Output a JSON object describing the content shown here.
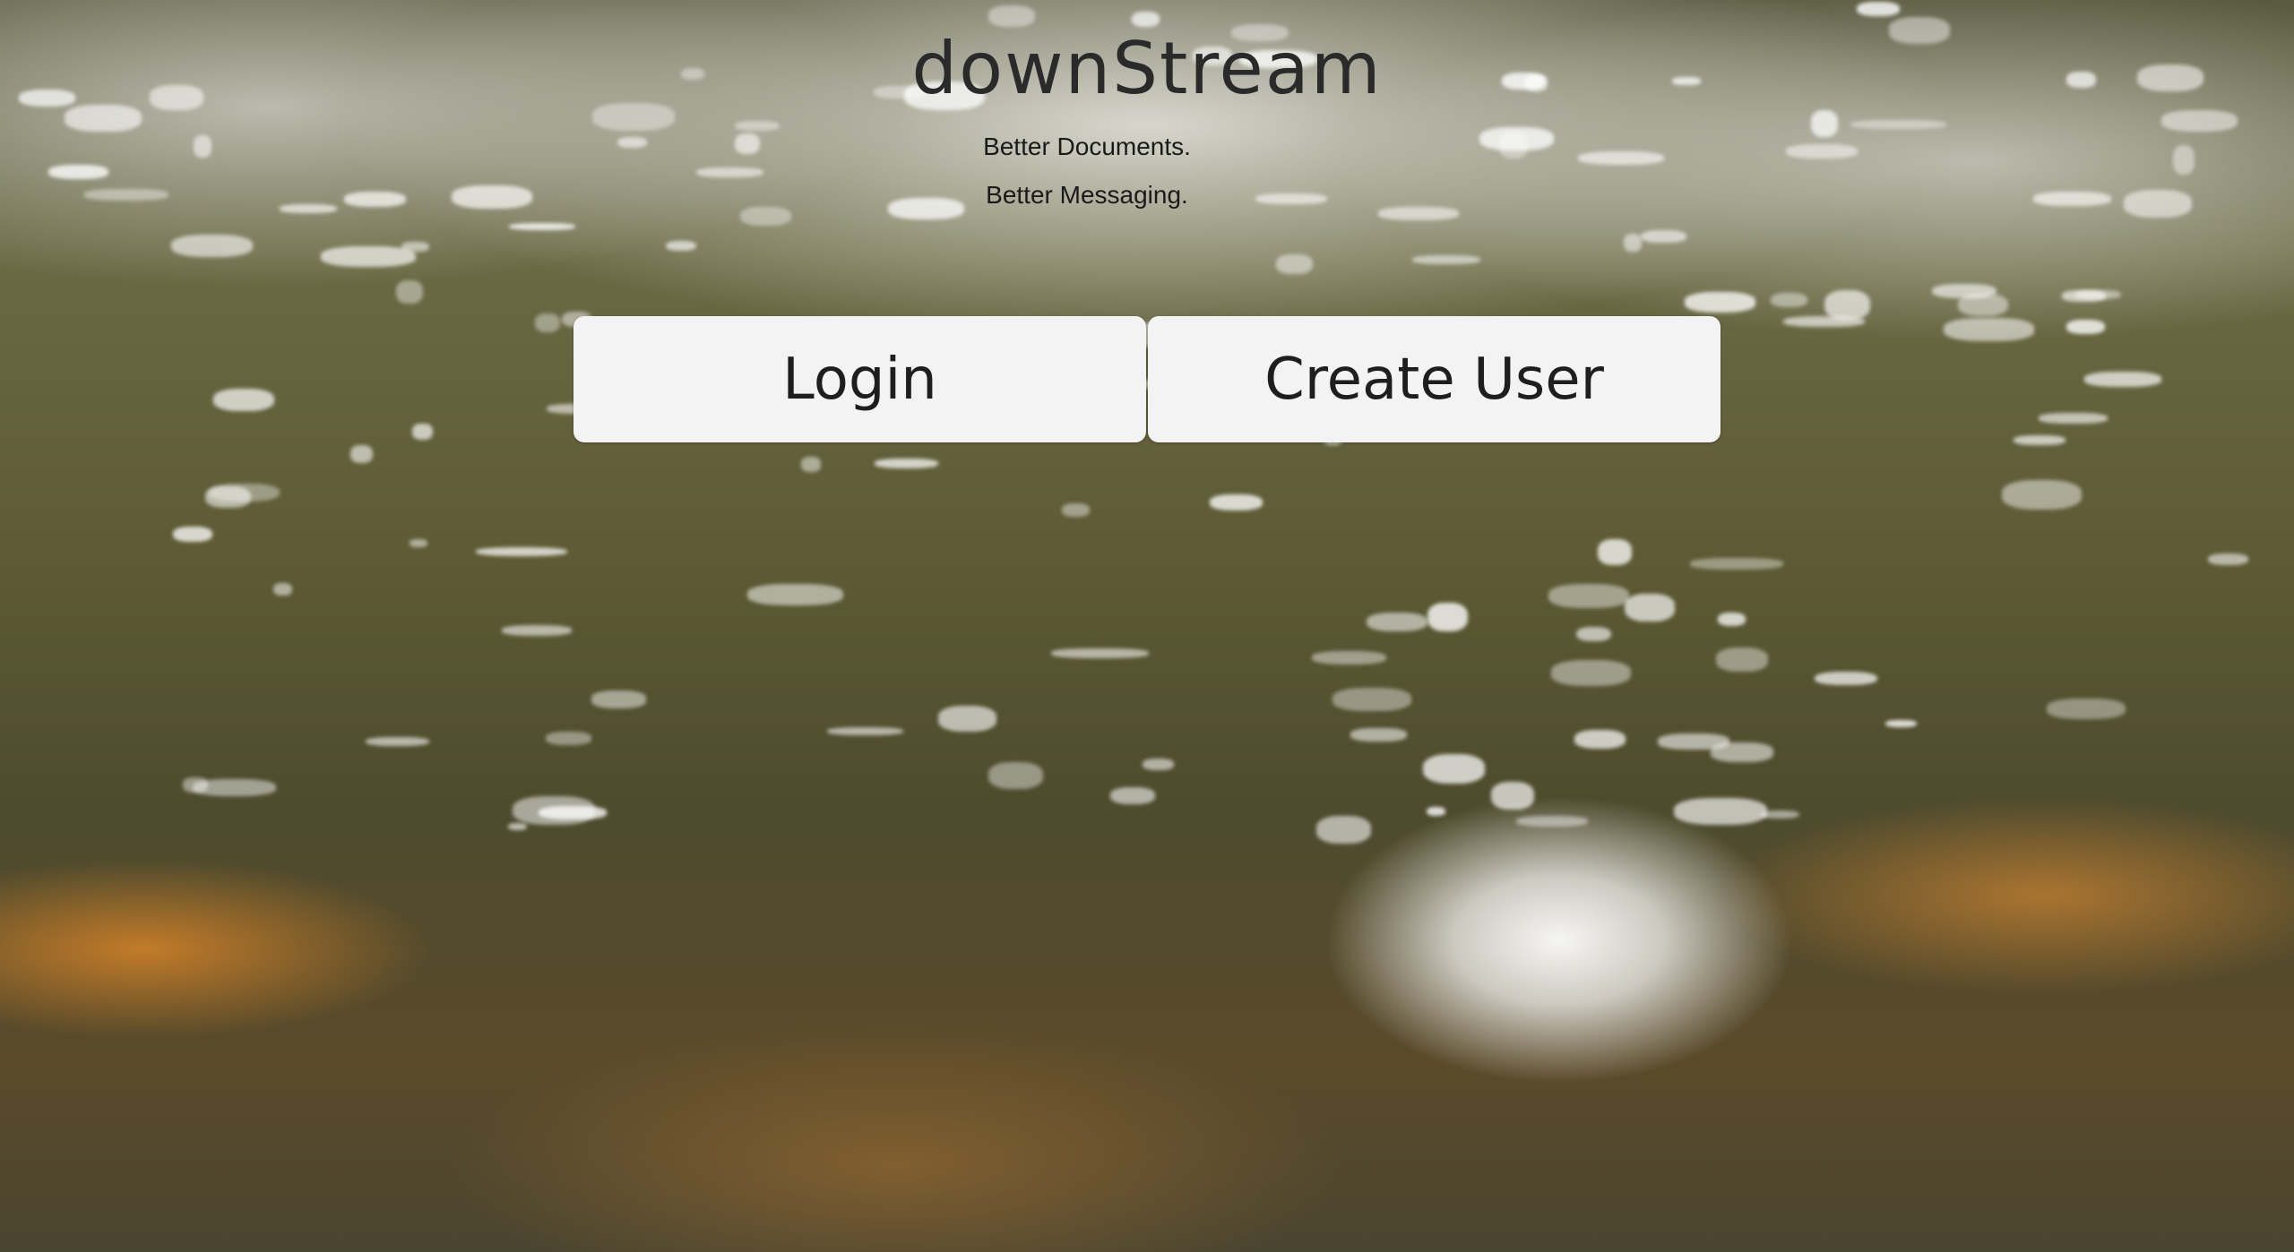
{
  "brand": {
    "name": "downStream",
    "tagline_line1": "Better Documents.",
    "tagline_line2": "Better Messaging."
  },
  "actions": {
    "login_label": "Login",
    "create_user_label": "Create User"
  },
  "background": {
    "description_icon": "stream-water-photo-background"
  }
}
